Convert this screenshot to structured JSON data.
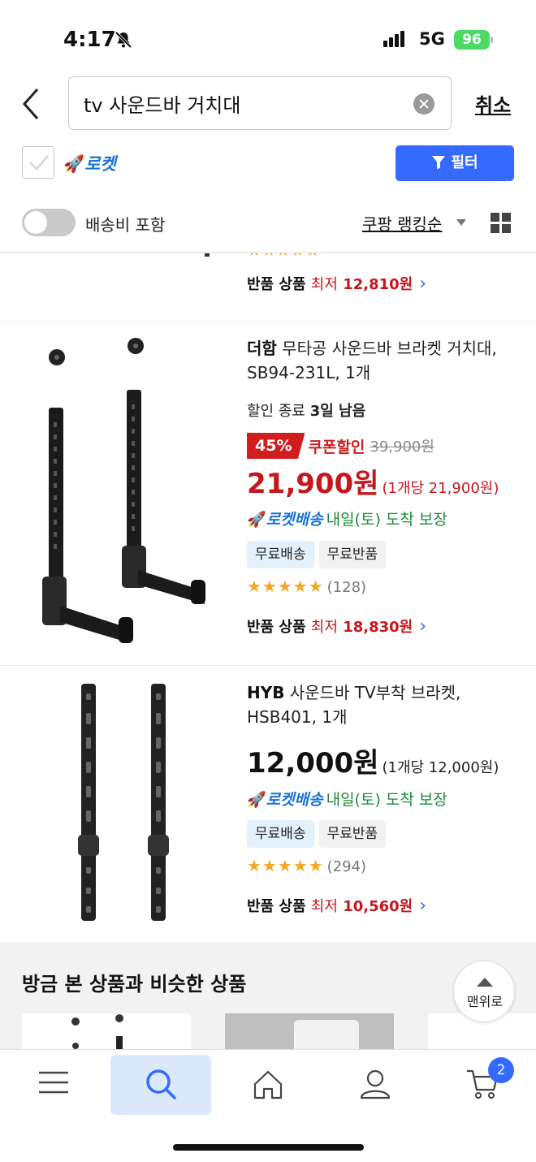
{
  "status_bar": {
    "time": "4:17",
    "network": "5G",
    "battery": "96"
  },
  "search": {
    "query": "tv 사운드바 거치대",
    "cancel_label": "취소"
  },
  "filters": {
    "rocket_label": "로켓",
    "filter_button": "필터",
    "shipping_toggle_label": "배송비 포함",
    "sort_label": "쿠팡 랭킹순"
  },
  "products": [
    {
      "returned_label": "반품 상품",
      "returned_lowest": "최저",
      "returned_price": "12,810원"
    },
    {
      "brand": "더함",
      "title": "무타공 사운드바 브라켓 거치대, SB94-231L, 1개",
      "deadline_prefix": "할인 종료",
      "deadline_value": "3일 남음",
      "discount": "45%",
      "coupon_label": "쿠폰할인",
      "original_price": "39,900원",
      "price": "21,900원",
      "unit_price": "(1개당 21,900원)",
      "rocket_label": "로켓배송",
      "eta": "내일(토) 도착 보장",
      "tags": [
        "무료배송",
        "무료반품"
      ],
      "rating": 4.5,
      "stars": "★★★★★",
      "review_count": "(128)",
      "returned_label": "반품 상품",
      "returned_lowest": "최저",
      "returned_price": "18,830원"
    },
    {
      "brand": "HYB",
      "title": "사운드바 TV부착 브라켓, HSB401, 1개",
      "price": "12,000원",
      "unit_price": "(1개당 12,000원)",
      "rocket_label": "로켓배송",
      "eta": "내일(토) 도착 보장",
      "tags": [
        "무료배송",
        "무료반품"
      ],
      "rating": 4.5,
      "stars": "★★★★★",
      "review_count": "(294)",
      "returned_label": "반품 상품",
      "returned_lowest": "최저",
      "returned_price": "10,560원"
    }
  ],
  "similar": {
    "title": "방금 본 상품과 비슷한 상품"
  },
  "scroll_top_label": "맨위로",
  "bottom_nav": {
    "cart_count": "2"
  },
  "colors": {
    "accent_blue": "#346aff",
    "price_red": "#c8161d",
    "rocket_blue": "#1a73d8",
    "eta_green": "#1c8a3a",
    "star": "#f5a623"
  }
}
